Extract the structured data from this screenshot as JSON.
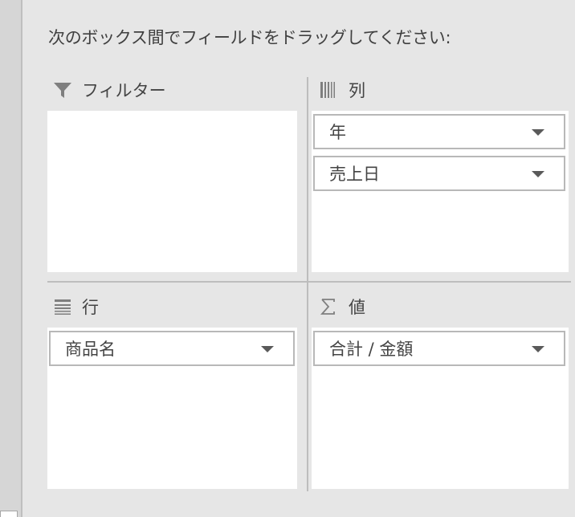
{
  "instruction": "次のボックス間でフィールドをドラッグしてください:",
  "areas": {
    "filter": {
      "title": "フィルター",
      "icon": "filter-icon",
      "fields": []
    },
    "columns": {
      "title": "列",
      "icon": "columns-icon",
      "fields": [
        "年",
        "売上日"
      ]
    },
    "rows": {
      "title": "行",
      "icon": "rows-icon",
      "fields": [
        "商品名"
      ]
    },
    "values": {
      "title": "値",
      "icon": "sigma-icon",
      "fields": [
        "合計 / 金額"
      ]
    }
  },
  "colors": {
    "panel_bg": "#e6e6e6",
    "box_bg": "#ffffff",
    "border": "#b8b8b8",
    "icon": "#7f7f7f"
  }
}
